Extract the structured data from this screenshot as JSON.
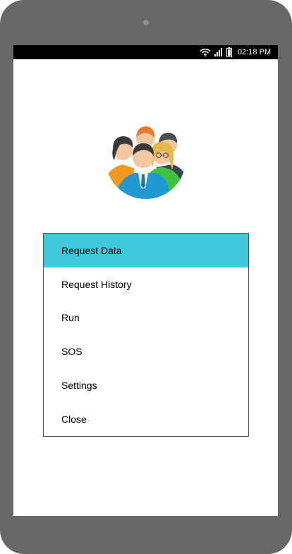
{
  "status_bar": {
    "time": "02:18 PM",
    "icons": [
      "wifi-icon",
      "signal-icon",
      "battery-icon"
    ]
  },
  "menu": {
    "items": [
      {
        "label": "Request Data",
        "active": true
      },
      {
        "label": "Request History",
        "active": false
      },
      {
        "label": "Run",
        "active": false
      },
      {
        "label": "SOS",
        "active": false
      },
      {
        "label": "Settings",
        "active": false
      },
      {
        "label": "Close",
        "active": false
      }
    ]
  },
  "colors": {
    "frame": "#686868",
    "active_item": "#40c8dc",
    "status_bar": "#000000"
  }
}
